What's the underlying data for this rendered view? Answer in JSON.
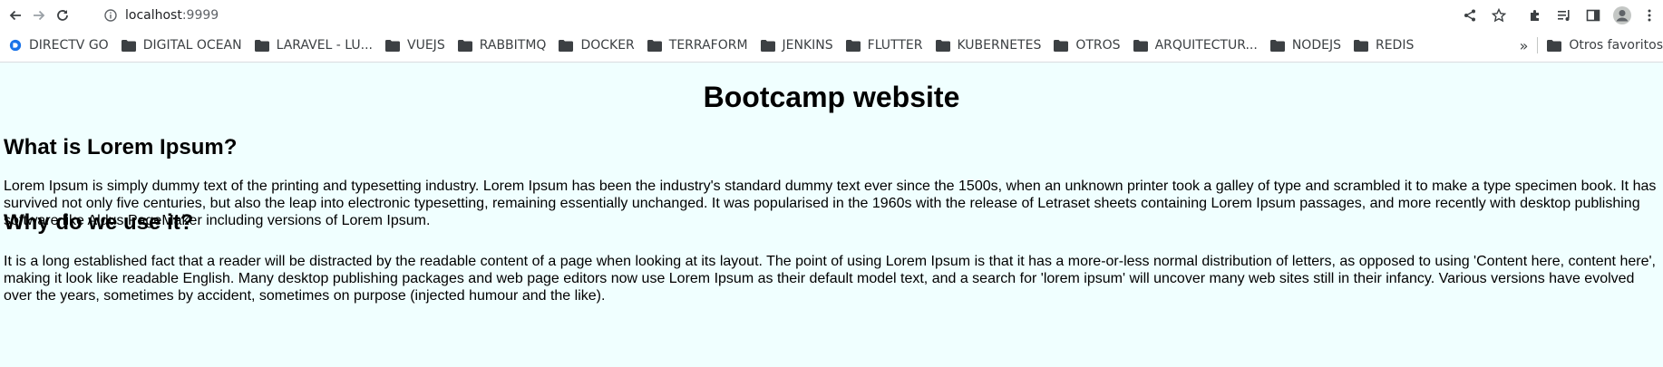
{
  "browser": {
    "url_host": "localhost",
    "url_port": ":9999",
    "bookmarks": [
      {
        "label": "DIRECTV GO",
        "icon": "directv-icon"
      },
      {
        "label": "DIGITAL OCEAN",
        "icon": "folder-icon"
      },
      {
        "label": "LARAVEL - LU...",
        "icon": "folder-icon"
      },
      {
        "label": "VUEJS",
        "icon": "folder-icon"
      },
      {
        "label": "RABBITMQ",
        "icon": "folder-icon"
      },
      {
        "label": "DOCKER",
        "icon": "folder-icon"
      },
      {
        "label": "TERRAFORM",
        "icon": "folder-icon"
      },
      {
        "label": "JENKINS",
        "icon": "folder-icon"
      },
      {
        "label": "FLUTTER",
        "icon": "folder-icon"
      },
      {
        "label": "KUBERNETES",
        "icon": "folder-icon"
      },
      {
        "label": "OTROS",
        "icon": "folder-icon"
      },
      {
        "label": "ARQUITECTUR...",
        "icon": "folder-icon"
      },
      {
        "label": "NODEJS",
        "icon": "folder-icon"
      },
      {
        "label": "REDIS",
        "icon": "folder-icon"
      }
    ],
    "overflow_label": "»",
    "other_bookmarks": "Otros favoritos"
  },
  "page": {
    "title": "Bootcamp website",
    "sections": [
      {
        "heading": "What is Lorem Ipsum?",
        "body": "Lorem Ipsum is simply dummy text of the printing and typesetting industry. Lorem Ipsum has been the industry's standard dummy text ever since the 1500s, when an unknown printer took a galley of type and scrambled it to make a type specimen book. It has survived not only five centuries, but also the leap into electronic typesetting, remaining essentially unchanged. It was popularised in the 1960s with the release of Letraset sheets containing Lorem Ipsum passages, and more recently with desktop publishing software like Aldus PageMaker including versions of Lorem Ipsum."
      },
      {
        "heading": "Why do we use it?",
        "body": "It is a long established fact that a reader will be distracted by the readable content of a page when looking at its layout. The point of using Lorem Ipsum is that it has a more-or-less normal distribution of letters, as opposed to using 'Content here, content here', making it look like readable English. Many desktop publishing packages and web page editors now use Lorem Ipsum as their default model text, and a search for 'lorem ipsum' will uncover many web sites still in their infancy. Various versions have evolved over the years, sometimes by accident, sometimes on purpose (injected humour and the like)."
      }
    ]
  },
  "colors": {
    "page_background": "#f0ffff",
    "directv_accent": "#1a73e8"
  }
}
